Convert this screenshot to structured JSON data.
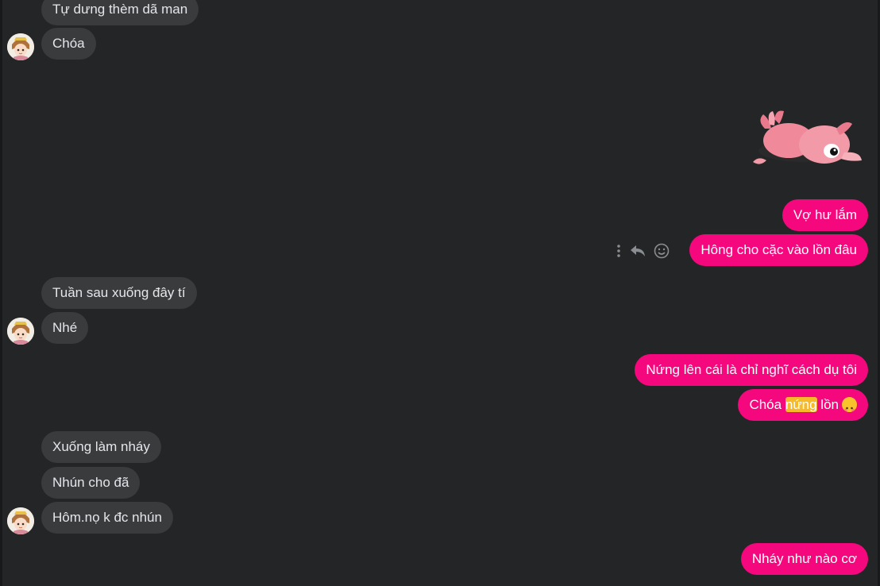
{
  "colors": {
    "background": "#242526",
    "incoming_bubble": "#3a3b3c",
    "incoming_text": "#e4e6eb",
    "outgoing_bubble": "#f5087d",
    "outgoing_text": "#ffffff",
    "search_highlight": "#f7b928"
  },
  "messages": [
    {
      "side": "incoming",
      "text": "Tự dưng thèm dã man"
    },
    {
      "side": "incoming",
      "text": "Chóa"
    },
    {
      "side": "outgoing",
      "type": "sticker",
      "sticker": "pink-pig-lying-icon"
    },
    {
      "side": "outgoing",
      "text": "Vợ hư lắm"
    },
    {
      "side": "outgoing",
      "text": "Hông cho cặc vào lồn đâu"
    },
    {
      "side": "incoming",
      "text": "Tuần sau xuống đây tí"
    },
    {
      "side": "incoming",
      "text": "Nhé"
    },
    {
      "side": "outgoing",
      "text": "Nứng lên cái là chỉ nghĩ cách dụ tôi"
    },
    {
      "side": "outgoing",
      "text_before": "Chóa ",
      "highlight": "nứng",
      "text_after": " lồn",
      "emoji": "flushed-face-icon"
    },
    {
      "side": "incoming",
      "text": "Xuống làm nháy"
    },
    {
      "side": "incoming",
      "text": "Nhún cho đã"
    },
    {
      "side": "incoming",
      "text": "Hôm.nọ k đc nhún"
    },
    {
      "side": "outgoing",
      "text": "Nháy như nào cơ"
    }
  ],
  "message_actions": [
    "more-options-icon",
    "reply-icon",
    "react-icon"
  ],
  "avatar": "contact-avatar"
}
